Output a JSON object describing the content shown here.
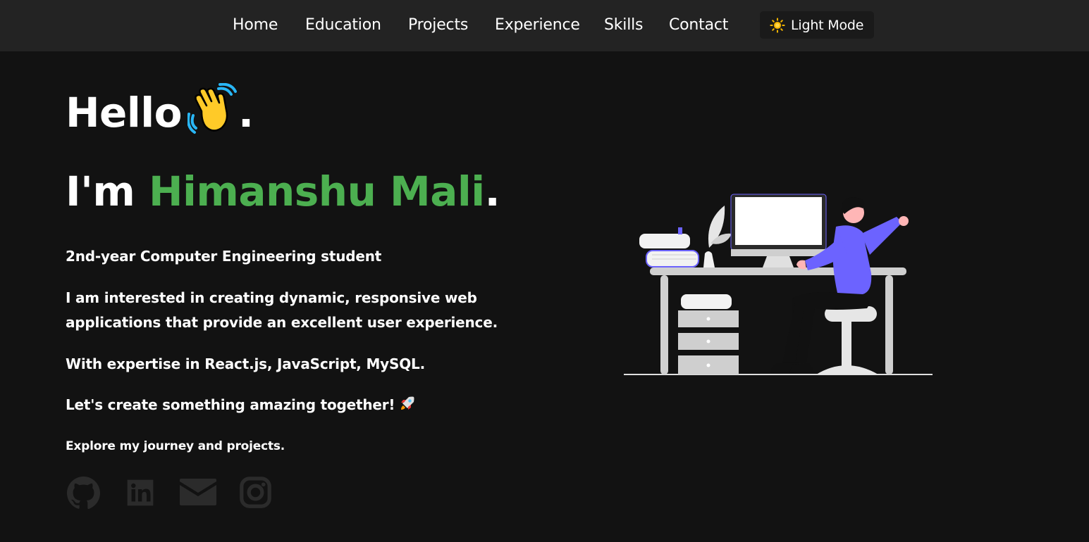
{
  "nav": {
    "links": [
      "Home",
      "Education",
      "Projects",
      "Experience",
      "Skills",
      "Contact"
    ],
    "theme_toggle": {
      "icon": "sun-icon",
      "label": "Light Mode"
    }
  },
  "hero": {
    "greeting": "Hello",
    "greeting_icon": "waving-hand-icon",
    "greeting_end": ".",
    "intro_prefix": "I'm ",
    "name": "Himanshu Mali",
    "intro_end": ".",
    "paragraphs": [
      "2nd-year Computer Engineering student",
      "I am interested in creating dynamic, responsive web applications that provide an excellent user experience.",
      "With expertise in React.js, JavaScript, MySQL.",
      "Let's create something amazing together!"
    ],
    "rocket_icon": "rocket-icon",
    "explore": "Explore my journey and projects."
  },
  "social": [
    "github-icon",
    "linkedin-icon",
    "mail-icon",
    "instagram-icon"
  ],
  "illustration": "person-working-at-desk-illustration",
  "colors": {
    "background": "#121212",
    "navbar": "#232323",
    "accent": "#4caf50",
    "social_icons": "#2b2b2b",
    "figure_shirt": "#6c63ff"
  }
}
